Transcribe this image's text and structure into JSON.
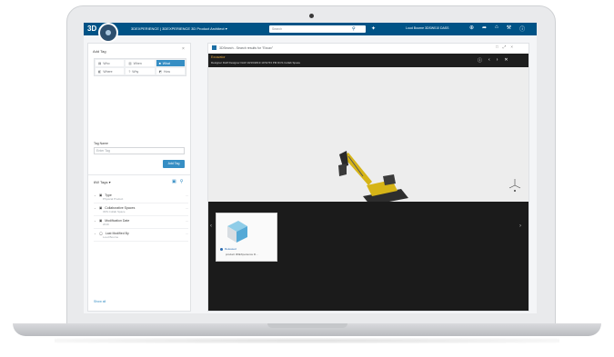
{
  "topbar": {
    "logo": "3D",
    "app_title": "3DEXPERIENCE | 3DEXPERIENCE 3D Product Architect ▾",
    "search_placeholder": "Search",
    "user": "Loud Bourne  3DSW010 DASS",
    "icons": [
      "plus-icon",
      "share-icon",
      "home-icon",
      "tools-icon",
      "help-icon"
    ]
  },
  "left_panel": {
    "title": "Add Tag",
    "close_glyph": "×",
    "tag_types": [
      {
        "icon": "▤",
        "label": "Who",
        "active": false
      },
      {
        "icon": "▥",
        "label": "When",
        "active": false
      },
      {
        "icon": "■",
        "label": "What",
        "active": true
      },
      {
        "icon": "◧",
        "label": "Where",
        "active": false
      },
      {
        "icon": "?",
        "label": "Why",
        "active": false
      },
      {
        "icon": "◩",
        "label": "How",
        "active": false
      }
    ],
    "tag_name_label": "Tag Name",
    "tag_name_placeholder": "Enter Tag",
    "add_tag_button": "Add Tag",
    "tags_header": "6W Tags ▾",
    "tags": [
      {
        "label": "Type",
        "value": "Physical Product"
      },
      {
        "label": "Collaborative Spaces",
        "value": "3DS Collab Space"
      },
      {
        "label": "Modification Date",
        "value": "2019"
      },
      {
        "label": "Last Modified By",
        "value": "Loud Bourne"
      }
    ],
    "show_all": "Show all"
  },
  "right_panel": {
    "title": "3DSearch - Search results for \"Excav\"",
    "window_controls": [
      "□",
      "⤢",
      "×"
    ],
    "viewer": {
      "object_title": "Excavator",
      "object_subtitle": "Designer Dolif   Designer Dolif   10/16/2019 10:52:53 PM  DCS Collab Space",
      "controls": [
        "ⓘ",
        "‹",
        "›",
        "✕"
      ],
      "thumbnail": {
        "status": "Released",
        "name": "product 3DEXperience D..."
      }
    }
  },
  "colors": {
    "brand_blue": "#005386",
    "accent_blue": "#368ec4",
    "viewer_dark": "#1e1e1e",
    "excavator_yellow": "#d6b417"
  }
}
